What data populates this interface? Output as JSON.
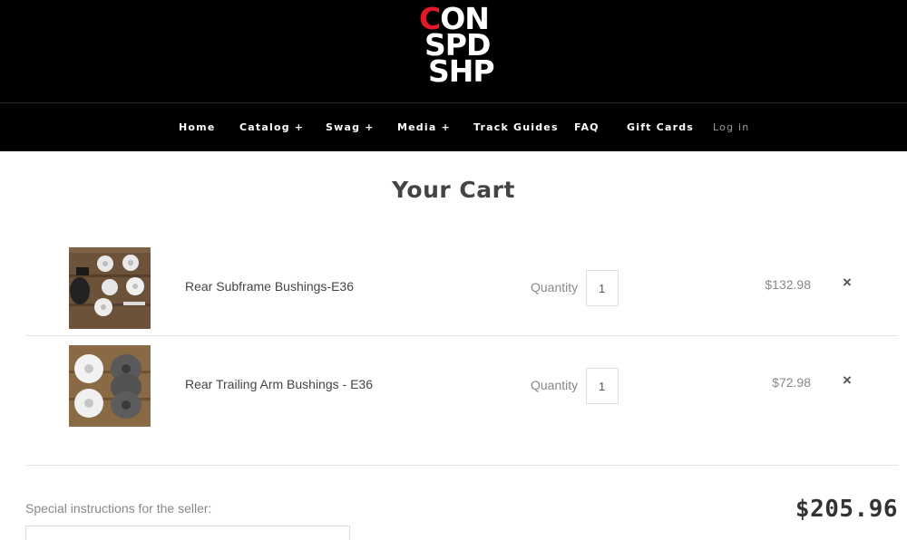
{
  "brand": {
    "logo_line1_accent": "C",
    "logo_line1": "ON",
    "logo_line2": "SPD",
    "logo_line3": "SHP"
  },
  "nav": {
    "items": [
      {
        "label": "Home"
      },
      {
        "label": "Catalog +"
      },
      {
        "label": "Swag +"
      },
      {
        "label": "Media +"
      },
      {
        "label": "Track Guides"
      },
      {
        "label": "FAQ"
      },
      {
        "label": "Gift Cards"
      },
      {
        "label": "Log in"
      }
    ]
  },
  "page": {
    "title": "Your Cart"
  },
  "cart": {
    "quantity_label": "Quantity",
    "remove_icon": "×",
    "items": [
      {
        "name": "Rear Subframe Bushings-E36",
        "quantity": "1",
        "price": "$132.98"
      },
      {
        "name": "Rear Trailing Arm Bushings - E36",
        "quantity": "1",
        "price": "$72.98"
      }
    ],
    "instructions_label": "Special instructions for the seller:",
    "total": "$205.96"
  },
  "colors": {
    "header_bg": "#000000",
    "logo_accent": "#e4172b",
    "text": "#444444",
    "muted": "#888888"
  }
}
